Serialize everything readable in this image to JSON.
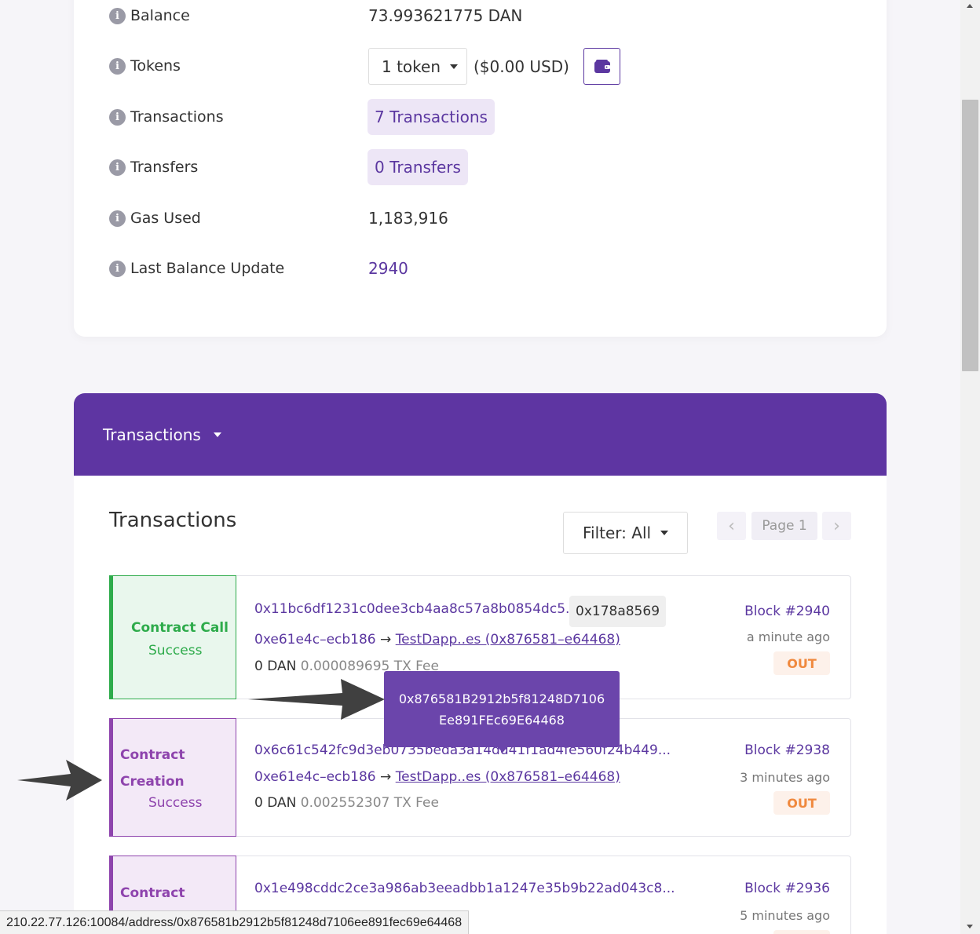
{
  "overview": {
    "balance": {
      "label": "Balance",
      "value": "73.993621775 DAN"
    },
    "tokens": {
      "label": "Tokens",
      "dropdown": "1 token",
      "usd": "($0.00 USD)"
    },
    "transactions": {
      "label": "Transactions",
      "value": "7 Transactions"
    },
    "transfers": {
      "label": "Transfers",
      "value": "0 Transfers"
    },
    "gas_used": {
      "label": "Gas Used",
      "value": "1,183,916"
    },
    "last_balance_update": {
      "label": "Last Balance Update",
      "value": "2940"
    }
  },
  "tx_panel": {
    "tab_label": "Transactions",
    "section_title": "Transactions",
    "filter_label": "Filter: All",
    "page_label": "Page 1",
    "prev": "‹",
    "next": "›"
  },
  "transactions": [
    {
      "type": "Contract Call",
      "status": "Success",
      "hash": "0x11bc6df1231c0dee3cb4aa8c57a8b0854dc5...",
      "method": "0x178a8569",
      "from": "0xe61e4c–ecb186",
      "arrow": "→",
      "to": "TestDapp..es (0x876581–e64468)",
      "amount": "0 DAN",
      "fee": "0.000089695 TX Fee",
      "block": "Block #2940",
      "age": "a minute ago",
      "direction": "OUT"
    },
    {
      "type_line1": "Contract",
      "type_line2": "Creation",
      "status": "Success",
      "hash": "0x6c61c542fc9d3eb0735beda3a14dd41f1ad4fe560f24b449...",
      "from": "0xe61e4c–ecb186",
      "arrow": "→",
      "to": "TestDapp..es (0x876581–e64468)",
      "amount": "0 DAN",
      "fee": "0.002552307 TX Fee",
      "block": "Block #2938",
      "age": "3 minutes ago",
      "direction": "OUT"
    },
    {
      "type_line1": "Contract",
      "hash": "0x1e498cddc2ce3a986ab3eeadbb1a1247e35b9b22ad043c8...",
      "block": "Block #2936",
      "age": "5 minutes ago"
    }
  ],
  "tooltip": {
    "line1": "0x876581B2912b5f81248D7106",
    "line2": "Ee891FEc69E64468"
  },
  "status_bar_url": "210.22.77.126:10084/address/0x876581b2912b5f81248d7106ee891fec69e64468",
  "colors": {
    "brand_purple": "#5e35a2",
    "success_green": "#2eab4b",
    "creation_purple": "#8e44ad",
    "out_orange": "#f0893e"
  }
}
